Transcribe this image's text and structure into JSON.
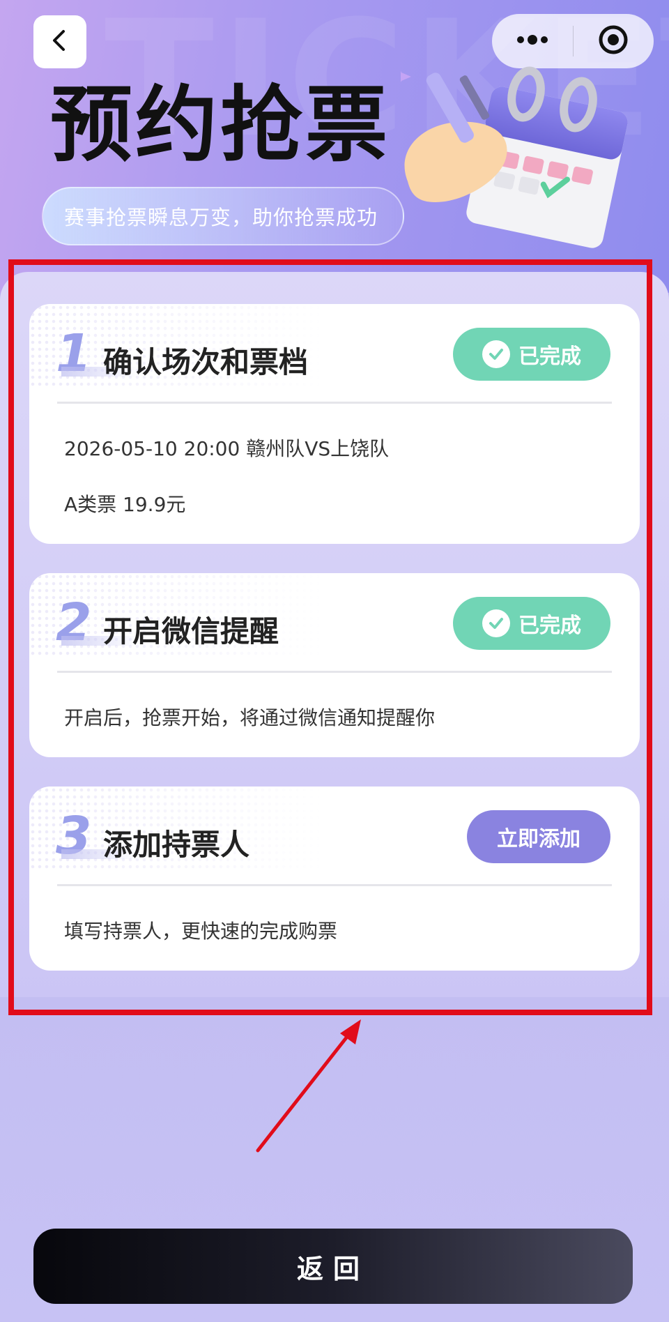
{
  "header": {
    "watermark": "TICKET",
    "title": "预约抢票",
    "subtitle": "赛事抢票瞬息万变，助你抢票成功"
  },
  "nav": {
    "back_icon": "chevron-left-icon",
    "more_icon": "more-dots-icon",
    "close_icon": "target-close-icon"
  },
  "steps": [
    {
      "number": "1",
      "title": "确认场次和票档",
      "status": "已完成",
      "details": [
        "2026-05-10 20:00 赣州队VS上饶队",
        "A类票   19.9元"
      ]
    },
    {
      "number": "2",
      "title": "开启微信提醒",
      "status": "已完成",
      "details": [
        "开启后，抢票开始，将通过微信通知提醒你"
      ]
    },
    {
      "number": "3",
      "title": "添加持票人",
      "action": "立即添加",
      "details": [
        "填写持票人，更快速的完成购票"
      ]
    }
  ],
  "footer": {
    "return_label": "返回"
  },
  "colors": {
    "completed": "#71d5b5",
    "action": "#8a83e0",
    "highlight": "#e10c1a"
  }
}
